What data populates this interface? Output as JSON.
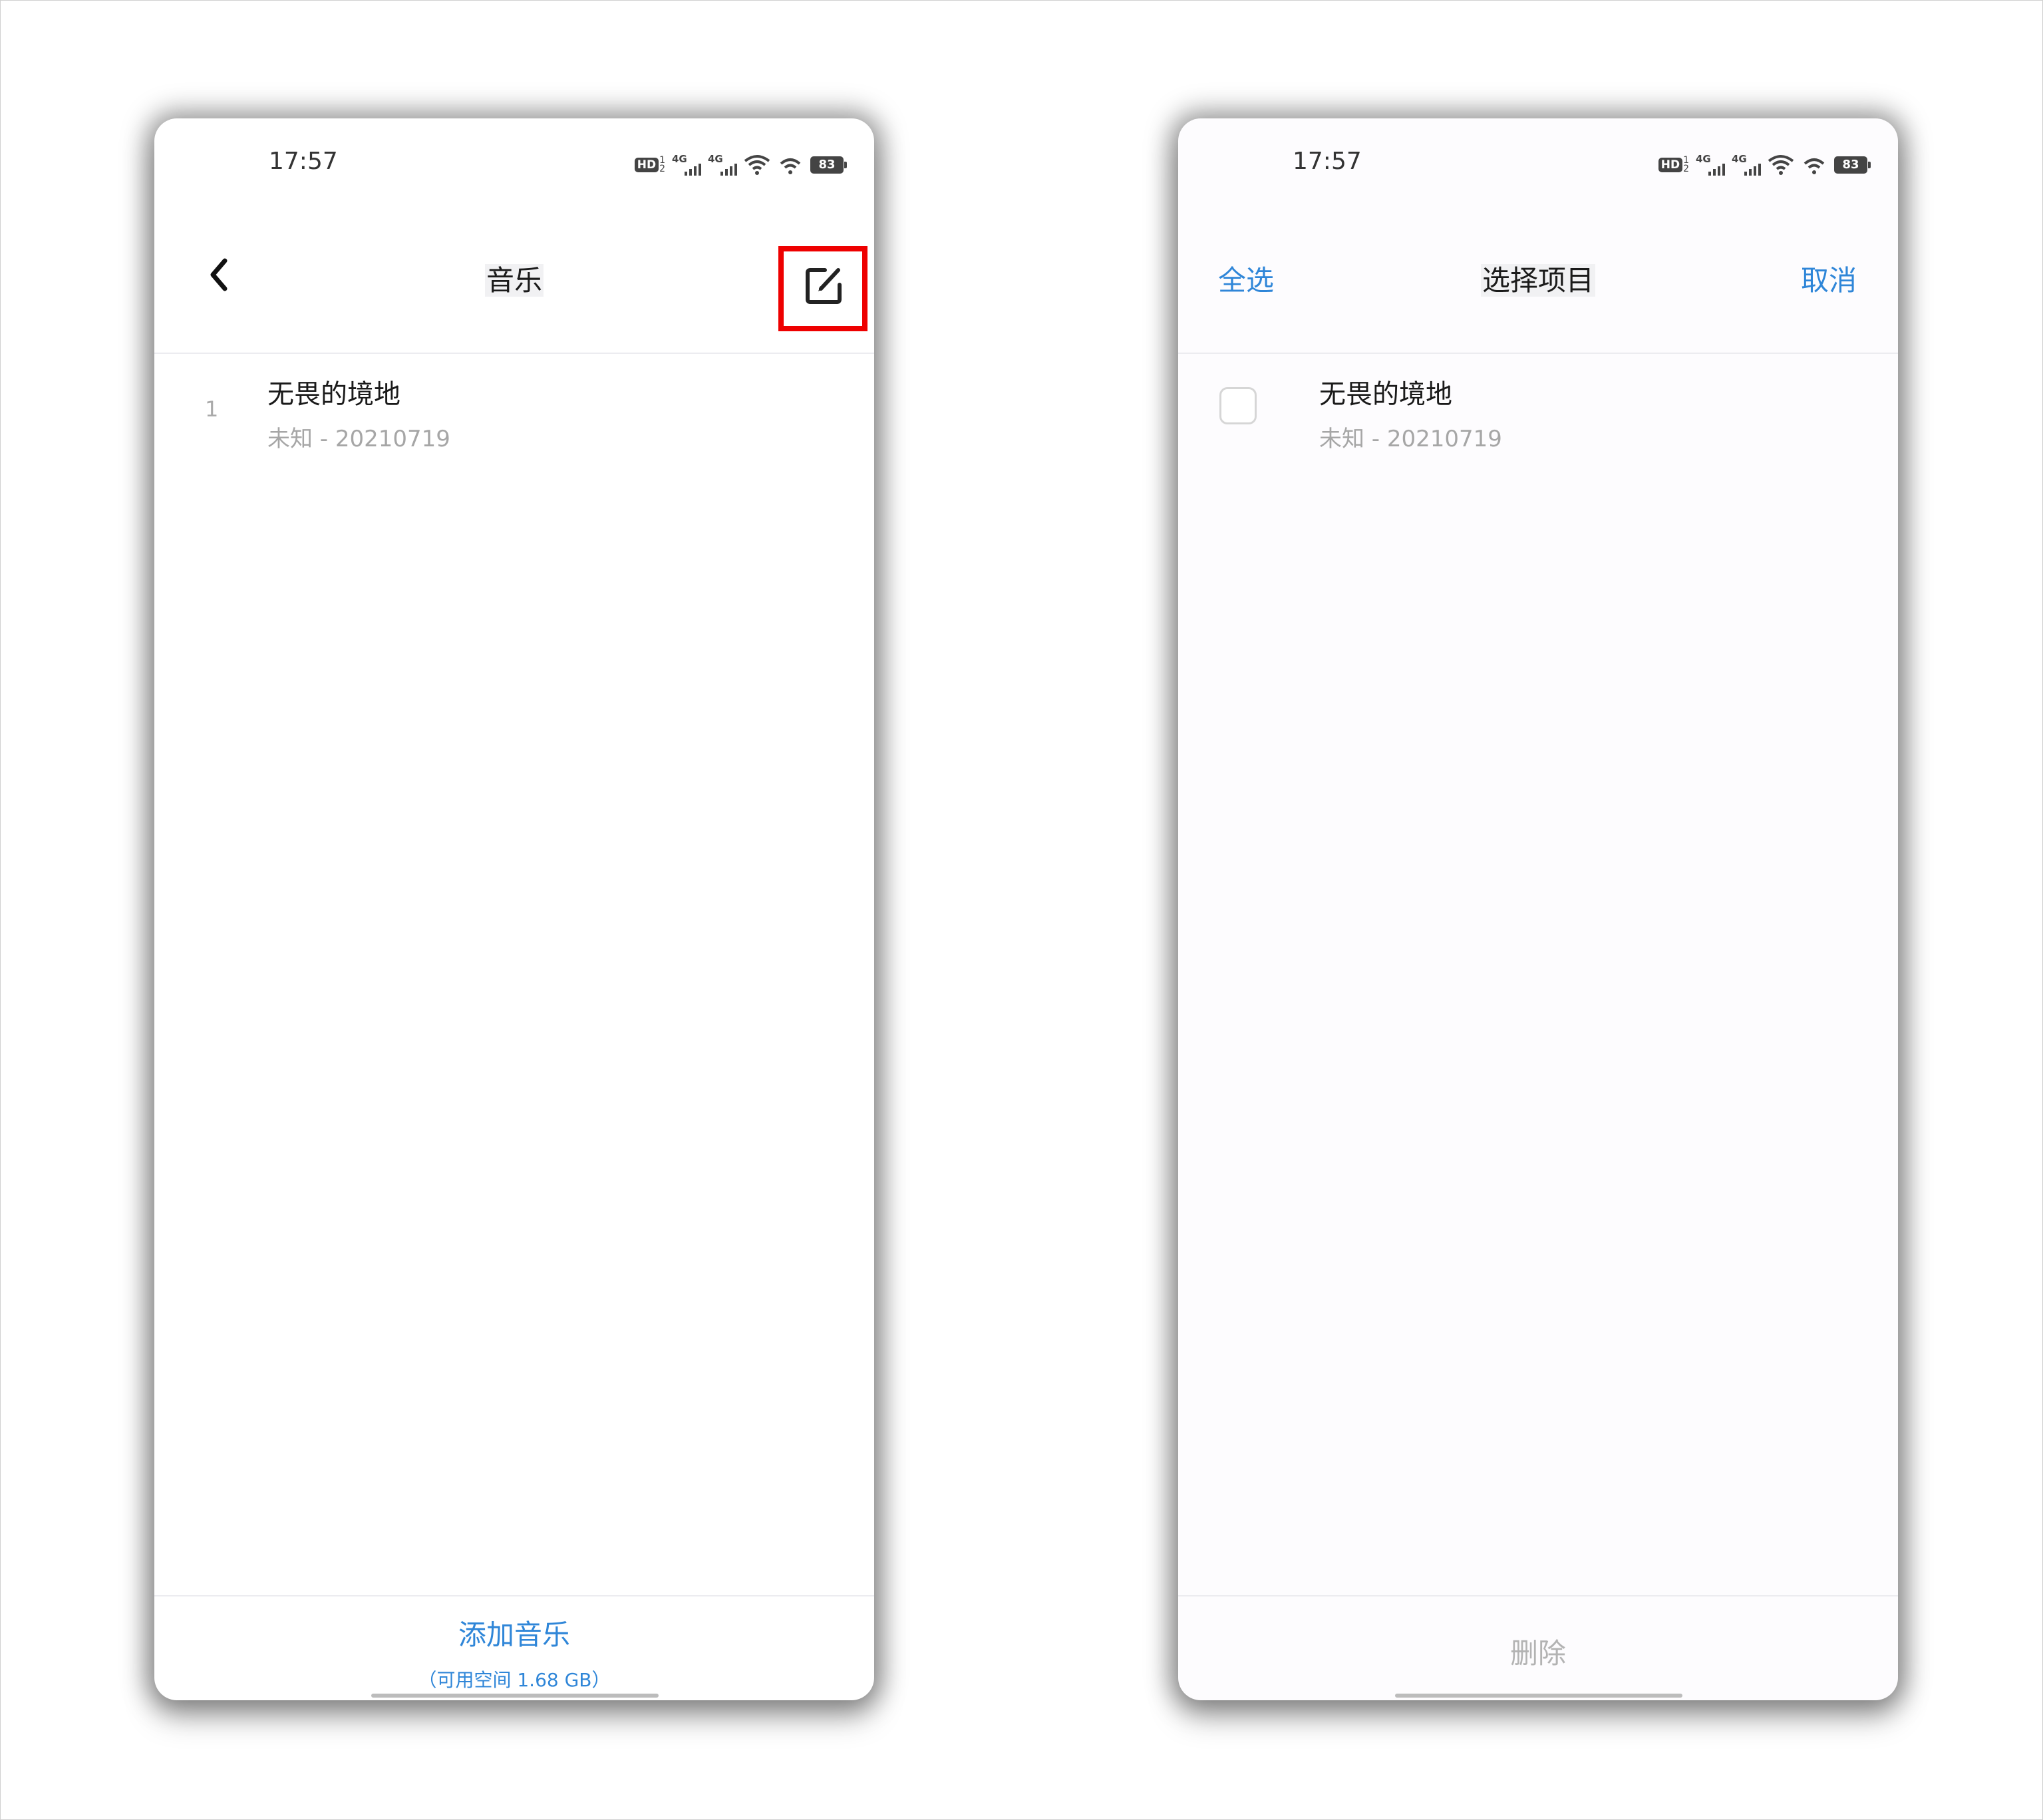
{
  "left_screen": {
    "status": {
      "time": "17:57",
      "battery": "83",
      "hd_label": "HD",
      "hd_sub_top": "1",
      "hd_sub_bottom": "2",
      "net1": "4G",
      "net2": "4G"
    },
    "nav": {
      "title": "音乐",
      "back_icon": "chevron-left-icon",
      "edit_icon": "edit-square-icon",
      "highlight_color": "#ee0000"
    },
    "songs": [
      {
        "index": "1",
        "title": "无畏的境地",
        "subtitle": "未知 - 20210719"
      }
    ],
    "bottom": {
      "add_label": "添加音乐",
      "free_space": "（可用空间 1.68 GB）"
    }
  },
  "right_screen": {
    "status": {
      "time": "17:57",
      "battery": "83",
      "hd_label": "HD",
      "hd_sub_top": "1",
      "hd_sub_bottom": "2",
      "net1": "4G",
      "net2": "4G"
    },
    "nav": {
      "select_all": "全选",
      "title": "选择项目",
      "cancel": "取消"
    },
    "songs": [
      {
        "title": "无畏的境地",
        "subtitle": "未知 - 20210719",
        "checked": false
      }
    ],
    "bottom": {
      "delete_label": "删除"
    }
  },
  "colors": {
    "accent": "#2f86d8",
    "disabled": "#b3b3b3",
    "highlight": "#ee0000"
  }
}
